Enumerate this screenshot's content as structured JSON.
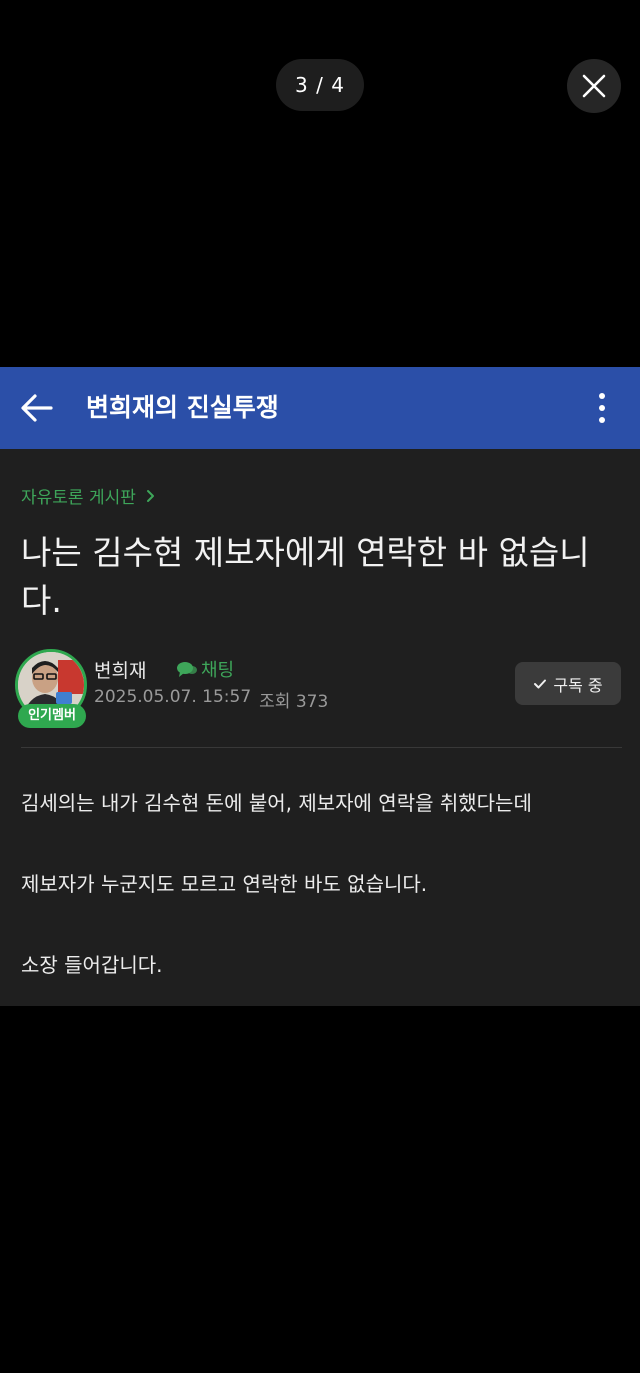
{
  "viewer": {
    "counter": "3 / 4",
    "close_icon": "close-icon"
  },
  "appbar": {
    "back_icon": "arrow-left-icon",
    "title": "변희재의 진실투쟁",
    "more_icon": "more-vertical-icon",
    "color": "#2b4fa8"
  },
  "post": {
    "board": "자유토론 게시판",
    "title": "나는 김수현 제보자에게 연락한 바 없습니다.",
    "author": {
      "name": "변희재",
      "badge": "인기멤버",
      "chat_label": "채팅",
      "date": "2025.05.07. 15:57",
      "views": "조회 373"
    },
    "subscribe_label": "구독 중",
    "body": [
      "김세의는 내가 김수현 돈에 붙어, 제보자에 연락을 취했다는데",
      "제보자가 누군지도 모르고 연락한 바도 없습니다.",
      "소장 들어갑니다."
    ]
  },
  "colors": {
    "accent_green": "#3ea65a",
    "background": "#1f1f1f"
  }
}
